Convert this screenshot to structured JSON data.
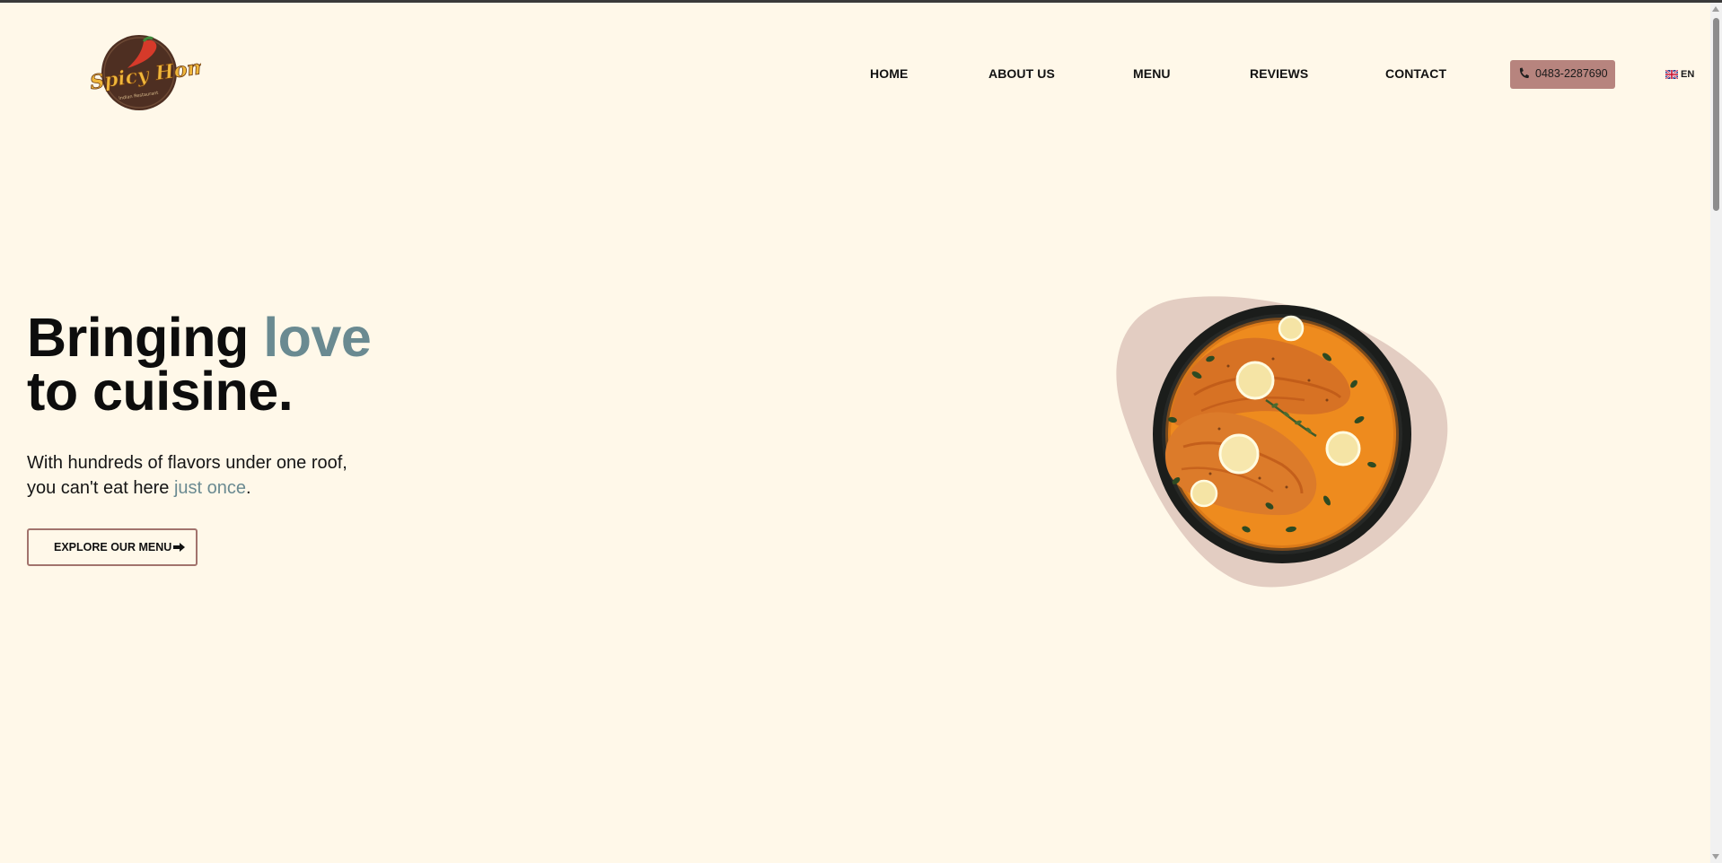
{
  "brand": {
    "logo_text": "Spicy Home",
    "logo_tagline": "Indian Restaurant"
  },
  "nav": {
    "items": [
      {
        "label": "HOME"
      },
      {
        "label": "ABOUT US"
      },
      {
        "label": "MENU"
      },
      {
        "label": "REVIEWS"
      },
      {
        "label": "CONTACT"
      }
    ],
    "phone": "0483-2287690",
    "language": "EN",
    "language_flag": "uk-flag-icon"
  },
  "hero": {
    "title_part1": "Bringing ",
    "title_highlight": "love",
    "title_line2": "to cuisine.",
    "subtitle_line1": "With hundreds of flavors under one roof,",
    "subtitle_line2_prefix": "you can't eat here ",
    "subtitle_highlight": "just once",
    "subtitle_line2_suffix": ".",
    "cta_label": "EXPLORE OUR MENU",
    "cta_icon": "arrow-right-icon",
    "image": "salmon-curry-bowl"
  },
  "colors": {
    "background": "#fff8e9",
    "accent_text": "#6a8a91",
    "phone_button": "#b7847e",
    "cta_border": "#a2736d",
    "blob": "#e3cdc2"
  }
}
